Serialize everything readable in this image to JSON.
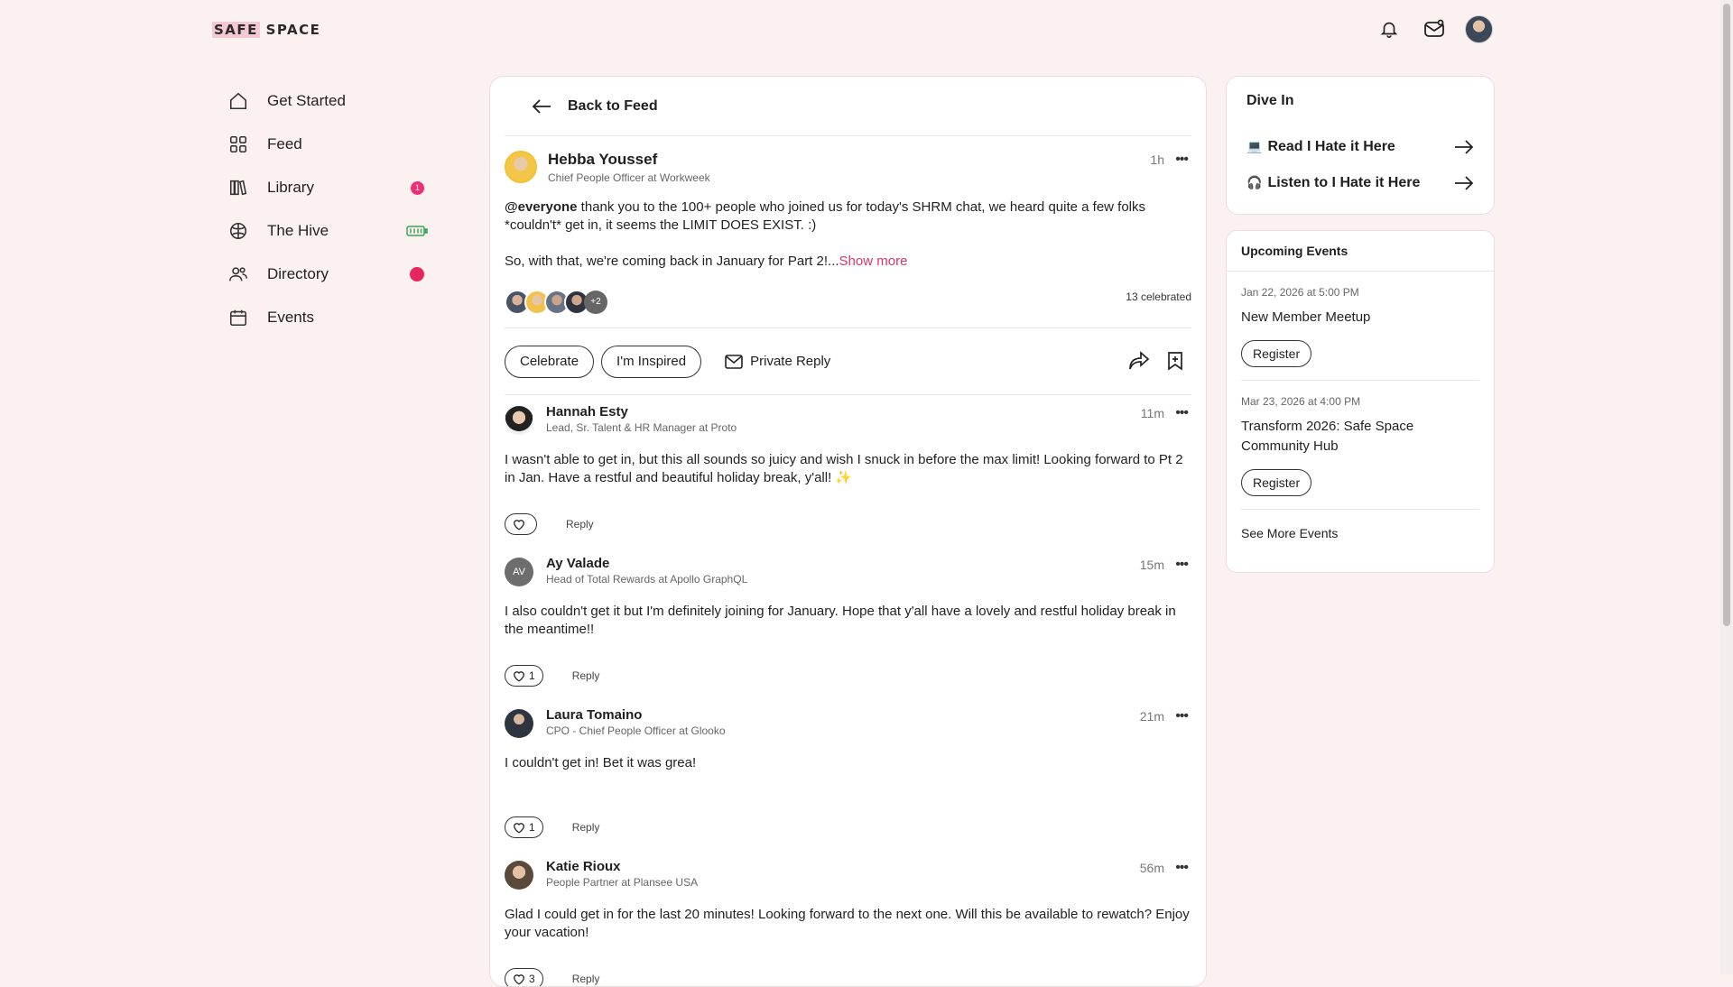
{
  "brand": {
    "logo_part1": "SAFE",
    "logo_part2": " SPACE"
  },
  "sidebar": {
    "items": [
      {
        "label": "Get Started",
        "icon": "home-icon"
      },
      {
        "label": "Feed",
        "icon": "grid-icon"
      },
      {
        "label": "Library",
        "icon": "library-icon",
        "badge": "1"
      },
      {
        "label": "The Hive",
        "icon": "hive-icon",
        "indicator": "battery-icon"
      },
      {
        "label": "Directory",
        "icon": "people-icon",
        "indicator": "red-dot"
      },
      {
        "label": "Events",
        "icon": "calendar-icon"
      }
    ]
  },
  "post": {
    "back_label": "Back to Feed",
    "author": "Hebba Youssef",
    "title": "Chief People Officer at Workweek",
    "time": "1h",
    "mention": "@everyone",
    "body1": " thank you to the 100+ people who joined us for today's SHRM chat, we heard quite a few folks *couldn't* get in, it seems the LIMIT DOES EXIST. :)",
    "body2": "So, with that, we're coming back in January for Part 2!...",
    "show_more": "Show more",
    "reactors_more": "+2",
    "celebrated": "13 celebrated",
    "btn_celebrate": "Celebrate",
    "btn_inspired": "I'm Inspired",
    "btn_private_reply": "Private Reply"
  },
  "comments": [
    {
      "name": "Hannah Esty",
      "title": "Lead, Sr. Talent & HR Manager at Proto",
      "time": "11m",
      "body": "I wasn't able to get in, but this all sounds so juicy and wish I snuck in before the max limit! Looking forward to Pt 2 in Jan. Have a restful and beautiful holiday break, y'all! ✨",
      "likes": "",
      "reply": "Reply"
    },
    {
      "name": "Ay Valade",
      "title": "Head of Total Rewards at Apollo GraphQL",
      "time": "15m",
      "initials": "AV",
      "body": "I also couldn't get it but I'm definitely joining for January. Hope that y'all have a lovely and restful holiday break in the meantime!!",
      "likes": "1",
      "reply": "Reply"
    },
    {
      "name": "Laura Tomaino",
      "title": "CPO - Chief People Officer at Glooko",
      "time": "21m",
      "body": "I couldn't get in! Bet it was grea!",
      "likes": "1",
      "reply": "Reply"
    },
    {
      "name": "Katie Rioux",
      "title": "People Partner at Plansee USA",
      "time": "56m",
      "body": "Glad I could get in for the last 20 minutes! Looking forward to the next one. Will this be available to rewatch? Enjoy your vacation!",
      "likes": "3",
      "reply": "Reply"
    }
  ],
  "dive_in": {
    "title": "Dive In",
    "links": [
      {
        "emoji": "💻",
        "label": "Read I Hate it Here"
      },
      {
        "emoji": "🎧",
        "label": "Listen to I Hate it Here"
      }
    ]
  },
  "events": {
    "title": "Upcoming Events",
    "items": [
      {
        "date": "Jan 22, 2026 at 5:00 PM",
        "name": "New Member Meetup",
        "button": "Register"
      },
      {
        "date": "Mar 23, 2026 at 4:00 PM",
        "name": "Transform 2026: Safe Space Community Hub",
        "button": "Register"
      }
    ],
    "see_more": "See More Events"
  },
  "colors": {
    "background": "#fcf1f1",
    "accent": "#d6366a",
    "badge": "#ee2f73"
  }
}
